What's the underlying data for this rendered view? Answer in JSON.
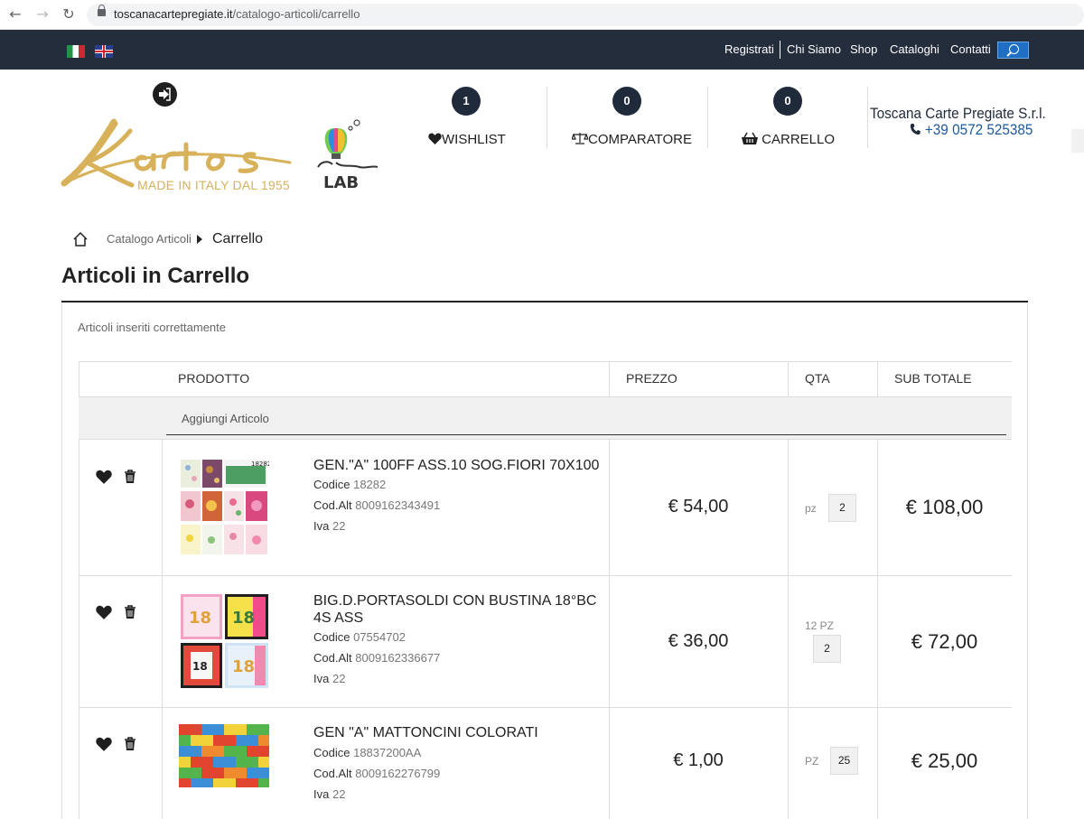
{
  "browser": {
    "domain": "toscanacartepregiate.it",
    "path": "/catalogo-articoli/carrello"
  },
  "topnav": {
    "links": [
      "Registrati",
      "Chi Siamo",
      "Shop",
      "Cataloghi",
      "Contatti"
    ]
  },
  "header": {
    "logo_tagline": "MADE IN ITALY DAL 1955",
    "wishlist": {
      "count": "1",
      "label": "WISHLIST"
    },
    "comparatore": {
      "count": "0",
      "label": "COMPARATORE"
    },
    "carrello": {
      "count": "0",
      "label": "CARRELLO"
    },
    "company": "Toscana Carte Pregiate S.r.l.",
    "phone": "+39 0572 525385"
  },
  "breadcrumb": {
    "parent": "Catalogo Articoli",
    "current": "Carrello"
  },
  "page_title": "Articoli in Carrello",
  "cart_message": "Articoli inseriti correttamente",
  "table": {
    "headers": {
      "product": "PRODOTTO",
      "price": "PREZZO",
      "qty": "QTA",
      "subtotal": "SUB TOTALE"
    },
    "add_label": "Aggiungi Articolo",
    "meta_labels": {
      "code": "Codice",
      "alt": "Cod.Alt",
      "vat": "Iva"
    },
    "rows": [
      {
        "name": "GEN.\"A\" 100FF ASS.10 SOG.FIORI 70X100",
        "code": "18282",
        "alt": "8009162343491",
        "vat": "22",
        "price": "€ 54,00",
        "unit": "pz",
        "qty": "2",
        "subtotal": "€ 108,00"
      },
      {
        "name": "BIG.D.PORTASOLDI CON BUSTINA 18°BC 4S ASS",
        "code": "07554702",
        "alt": "8009162336677",
        "vat": "22",
        "price": "€ 36,00",
        "unit": "12 PZ",
        "qty": "2",
        "subtotal": "€ 72,00"
      },
      {
        "name": "GEN \"A\" MATTONCINI COLORATI",
        "code": "18837200AA",
        "alt": "8009162276799",
        "vat": "22",
        "price": "€ 1,00",
        "unit": "PZ",
        "qty": "25",
        "subtotal": "€ 25,00"
      }
    ]
  },
  "colors": {
    "topnav_bg": "#242d3c",
    "gold": "#d7b25a",
    "badge": "#1f2a3a",
    "link_blue": "#1e5a9c"
  }
}
